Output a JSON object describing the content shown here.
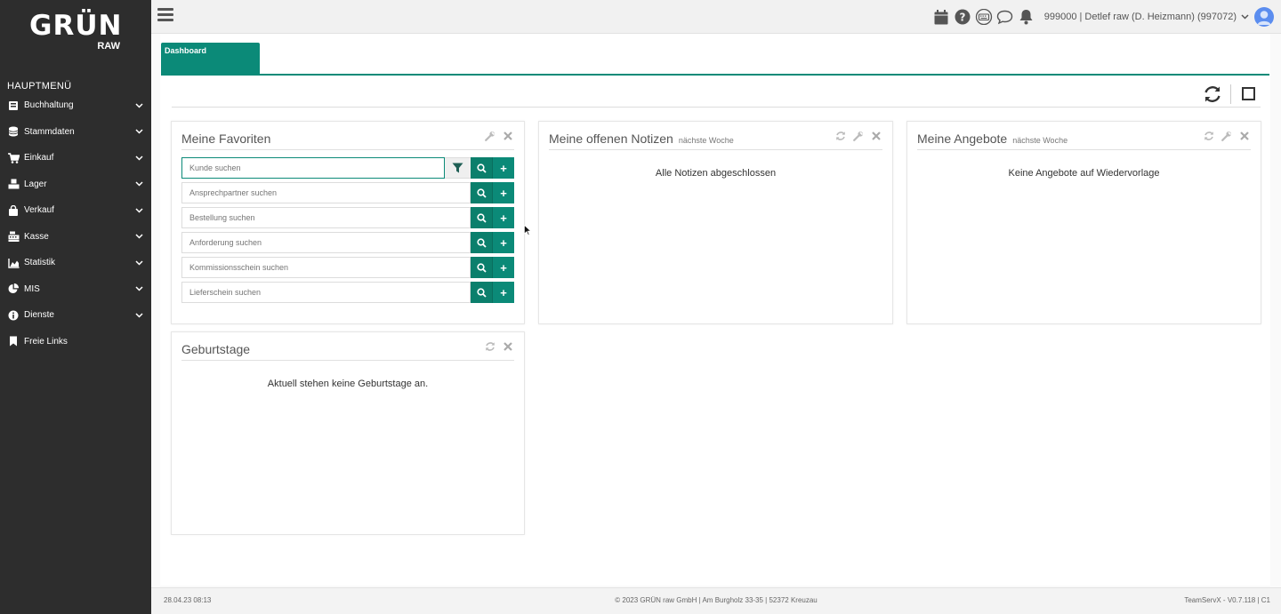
{
  "brand": {
    "name": "GRÜN",
    "sub": "RAW"
  },
  "sidebar": {
    "title": "HAUPTMENÜ",
    "items": [
      {
        "label": "Buchhaltung",
        "icon": "book-icon",
        "has_children": true
      },
      {
        "label": "Stammdaten",
        "icon": "database-icon",
        "has_children": true
      },
      {
        "label": "Einkauf",
        "icon": "cart-icon",
        "has_children": true
      },
      {
        "label": "Lager",
        "icon": "cubes-icon",
        "has_children": true
      },
      {
        "label": "Verkauf",
        "icon": "shopping-bag-icon",
        "has_children": true
      },
      {
        "label": "Kasse",
        "icon": "cash-register-icon",
        "has_children": true
      },
      {
        "label": "Statistik",
        "icon": "area-chart-icon",
        "has_children": true
      },
      {
        "label": "MIS",
        "icon": "pie-chart-icon",
        "has_children": true
      },
      {
        "label": "Dienste",
        "icon": "info-icon",
        "has_children": true
      },
      {
        "label": "Freie Links",
        "icon": "bookmark-icon",
        "has_children": false
      }
    ]
  },
  "topbar": {
    "user": "999000 | Detlef raw (D. Heizmann) (997072)",
    "icons": [
      "calendar-icon",
      "help-icon",
      "keyboard-icon",
      "chat-icon",
      "bell-icon"
    ]
  },
  "tabs": [
    {
      "label": "Dashboard",
      "active": true
    }
  ],
  "panels": {
    "favoriten": {
      "title": "Meine Favoriten",
      "rows": [
        {
          "placeholder": "Kunde suchen",
          "filter": true
        },
        {
          "placeholder": "Ansprechpartner suchen"
        },
        {
          "placeholder": "Bestellung suchen"
        },
        {
          "placeholder": "Anforderung suchen"
        },
        {
          "placeholder": "Kommissionsschein suchen"
        },
        {
          "placeholder": "Lieferschein suchen"
        }
      ]
    },
    "notizen": {
      "title": "Meine offenen Notizen",
      "subtitle": "nächste Woche",
      "message": "Alle Notizen abgeschlossen"
    },
    "angebote": {
      "title": "Meine Angebote",
      "subtitle": "nächste Woche",
      "message": "Keine Angebote auf Wiedervorlage"
    },
    "geburtstage": {
      "title": "Geburtstage",
      "message": "Aktuell stehen keine Geburtstage an."
    }
  },
  "footer": {
    "timestamp": "28.04.23 08:13",
    "copyright": "© 2023 GRÜN raw GmbH | Am Burgholz 33-35 | 52372 Kreuzau",
    "version": "TeamServX - V0.7.118 | C1"
  },
  "colors": {
    "sidebar": "#2d2d2d",
    "accent": "#0b8a78",
    "accent_dark": "#0b7f6c"
  }
}
